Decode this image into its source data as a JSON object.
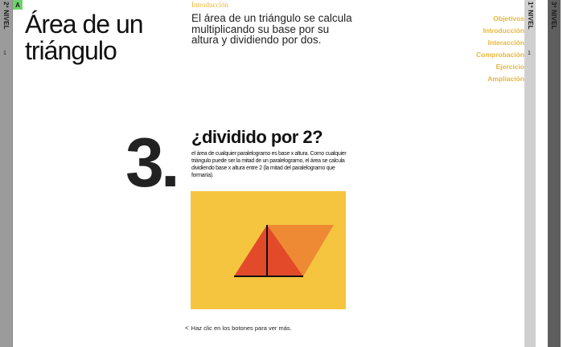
{
  "levels": {
    "left": {
      "label": "2º NIVEL",
      "num": "1"
    },
    "right1": {
      "label": "1º NIVEL",
      "num": "1"
    },
    "right2": {
      "label": "3º NIVEL"
    }
  },
  "badge": "A",
  "title": "Área de un triángulo",
  "section_label": "Introducción",
  "intro": "El área de un triángulo se calcula multiplicando su base por su altura y dividiendo por dos.",
  "nav": [
    "Objetivos",
    "Introducción",
    "Interacción",
    "Comprobación",
    "Ejercicio",
    "Ampliación"
  ],
  "step_number": "3.",
  "headline": "¿dividido por 2?",
  "description": "el área de cualquier paralelogramo es base x altura. Como cualquier triángulo puede ser la mitad de un paralelogramo, el área se calcula dividiendo base x altura entre 2 (la mitad del paralelogramo que formaría).",
  "hint": "Haz clic en los botones para ver más.",
  "hint_arrow": "<",
  "colors": {
    "accent": "#e8b63a",
    "panel": "#f5c540",
    "triangle": "#e24a2a",
    "parallelogram": "#ee8a33",
    "line": "#111111"
  }
}
